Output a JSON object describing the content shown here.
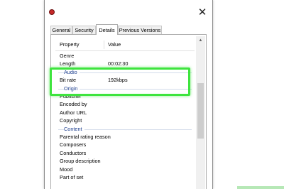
{
  "dialog": {
    "close_glyph": "✕",
    "tabs": [
      {
        "label": "General"
      },
      {
        "label": "Security"
      },
      {
        "label": "Details"
      },
      {
        "label": "Previous Versions"
      }
    ],
    "active_tab": "Details",
    "columns": {
      "property": "Property",
      "value": "Value"
    },
    "rows": [
      {
        "type": "item",
        "key": "Genre",
        "value": ""
      },
      {
        "type": "item",
        "key": "Length",
        "value": "00:02:30"
      },
      {
        "type": "group",
        "key": "Audio"
      },
      {
        "type": "item",
        "key": "Bit rate",
        "value": "192kbps"
      },
      {
        "type": "group",
        "key": "Origin"
      },
      {
        "type": "item",
        "key": "Publisher",
        "value": ""
      },
      {
        "type": "item",
        "key": "Encoded by",
        "value": ""
      },
      {
        "type": "item",
        "key": "Author URL",
        "value": ""
      },
      {
        "type": "item",
        "key": "Copyright",
        "value": ""
      },
      {
        "type": "group",
        "key": "Content"
      },
      {
        "type": "item",
        "key": "Parental rating reason",
        "value": ""
      },
      {
        "type": "item",
        "key": "Composers",
        "value": ""
      },
      {
        "type": "item",
        "key": "Conductors",
        "value": ""
      },
      {
        "type": "item",
        "key": "Group description",
        "value": ""
      },
      {
        "type": "item",
        "key": "Mood",
        "value": ""
      },
      {
        "type": "item",
        "key": "Part of set",
        "value": ""
      }
    ],
    "scroll_up_glyph": "▲"
  },
  "colors": {
    "highlight": "#3ee43e",
    "group_header": "#1e3f8f",
    "app_icon": "#c62828"
  },
  "icons": {
    "app": "media-file-icon",
    "close": "close-icon"
  }
}
